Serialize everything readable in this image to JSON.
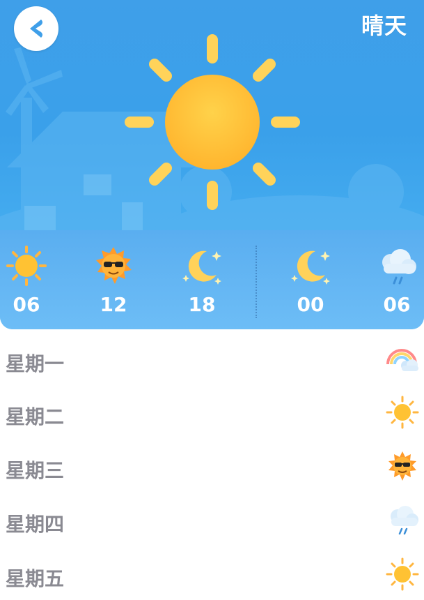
{
  "header": {
    "title": "晴天",
    "back_icon": "back-arrow-icon",
    "main_weather_icon": "sun-icon",
    "background_color": "#3fa0ea"
  },
  "hourly": [
    {
      "time": "06",
      "icon": "sun-icon"
    },
    {
      "time": "12",
      "icon": "sun-sunglasses-icon"
    },
    {
      "time": "18",
      "icon": "moon-stars-icon"
    },
    {
      "time": "00",
      "icon": "moon-stars-icon"
    },
    {
      "time": "06",
      "icon": "rain-cloud-icon"
    }
  ],
  "daily": [
    {
      "day": "星期一",
      "icon": "rainbow-cloud-icon"
    },
    {
      "day": "星期二",
      "icon": "sun-icon"
    },
    {
      "day": "星期三",
      "icon": "sun-sunglasses-icon"
    },
    {
      "day": "星期四",
      "icon": "rain-cloud-icon"
    },
    {
      "day": "星期五",
      "icon": "sun-icon"
    }
  ],
  "colors": {
    "sun": "#ffc233",
    "sun_ray": "#ffd35a",
    "day_text": "#8a8a92"
  }
}
